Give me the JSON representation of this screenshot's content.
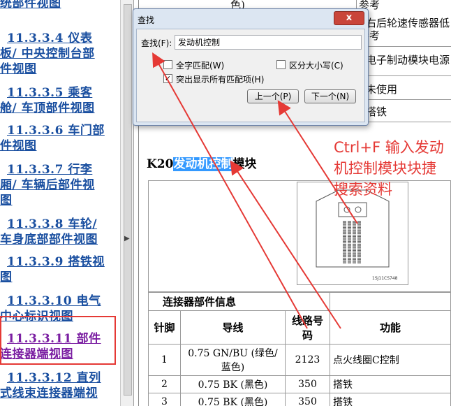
{
  "toc": {
    "items": [
      {
        "line1": "统部件视图",
        "line2": ""
      },
      {
        "line1": "11.3.3.4 仪表",
        "line2": "板/ 中央控制台部",
        "line3": "件视图"
      },
      {
        "line1": "11.3.3.5 乘客",
        "line2": "舱/ 车顶部件视图"
      },
      {
        "line1": "11.3.3.6 车门部",
        "line2": "件视图"
      },
      {
        "line1": "11.3.3.7 行李",
        "line2": "厢/ 车辆后部件视",
        "line3": "图"
      },
      {
        "line1": "11.3.3.8 车轮/",
        "line2": "车身底部部件视图"
      },
      {
        "line1": "11.3.3.9 搭铁视",
        "line2": "图"
      },
      {
        "line1": "11.3.3.10 电气",
        "line2": "中心标识视图"
      },
      {
        "line1": "11.3.3.11 部件",
        "line2": "连接器端视图"
      },
      {
        "line1": "11.3.3.12 直列",
        "line2": "式线束连接器端视"
      }
    ]
  },
  "doc": {
    "top_cells": [
      "色)",
      "参考",
      "右后轮速传感器低",
      "参考",
      "电子制动模块电源",
      "未使用",
      "搭铁"
    ],
    "heading_prefix": "K20",
    "heading_highlight": "发动机控制",
    "heading_suffix": "模块",
    "image_code": "1SJ11CS748",
    "table": {
      "section_header": "连接器部件信息",
      "columns": [
        "针脚",
        "导线",
        "线路号码",
        "功能"
      ],
      "rows": [
        {
          "pin": "1",
          "wire": "0.75 GN/BU (绿色/蓝色)",
          "circuit": "2123",
          "function": "点火线圈C控制"
        },
        {
          "pin": "2",
          "wire": "0.75 BK (黑色)",
          "circuit": "350",
          "function": "搭铁"
        },
        {
          "pin": "3",
          "wire": "0.75 BK (黑色)",
          "circuit": "350",
          "function": "搭铁"
        }
      ]
    }
  },
  "find_dialog": {
    "title": "查找",
    "close_glyph": "x",
    "find_label": "查找(F):",
    "find_value": "发动机控制",
    "whole_word_label": "全字匹配(W)",
    "whole_word_checked": false,
    "match_case_label": "区分大小写(C)",
    "match_case_checked": false,
    "highlight_all_label": "突出显示所有匹配项(H)",
    "highlight_all_checked": true,
    "prev_label": "上一个(P)",
    "next_label": "下一个(N)"
  },
  "annotation": {
    "text": "Ctrl+F 输入发动机控制模块块捷搜索资料",
    "color": "#e53935"
  },
  "colors": {
    "link": "#1a4fa0",
    "visited_link": "#7b1fa2",
    "highlight": "#3399ff"
  }
}
